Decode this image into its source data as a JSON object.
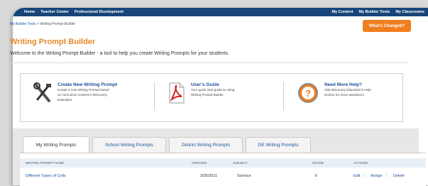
{
  "topnav": {
    "left": [
      "Home",
      "Teacher Center",
      "Professional Development"
    ],
    "right": [
      "My Content",
      "My Builder Tools",
      "My Classrooms"
    ]
  },
  "breadcrumb": {
    "link": "My Builder Tools",
    "sep": " > ",
    "current": "Writing Prompt Builder"
  },
  "whats_changed": "What's Changed?",
  "title": "Writing Prompt Builder",
  "welcome": "Welcome to the Writing Prompt Builder - a tool to help you create Writing Prompts for your students.",
  "info": {
    "create": {
      "title": "Create New Writing Prompt",
      "desc": [
        "Create a new Writing Prompt based",
        "on curriculum content in Discovery",
        "Education"
      ]
    },
    "guide": {
      "title": "User's Guide",
      "desc": [
        "Your quick start guide to using",
        "Writing Prompt Builder"
      ]
    },
    "help": {
      "title": "Need More Help?",
      "desc": [
        "Visit Discovery Education's Help",
        "section for more assistance"
      ]
    }
  },
  "tabs": [
    "My Writing Prompts",
    "School Writing Prompts",
    "District Writing Prompts",
    "DE Writing Prompts"
  ],
  "table": {
    "headers": [
      "WRITING PROMPT NAME",
      "CREATED",
      "SUBJECT",
      "GRADE",
      "ACTIONS"
    ],
    "row": {
      "name": "Different Types of Cells",
      "created": "3/25/2011",
      "subject": "Science",
      "grade": "6",
      "actions": [
        "Edit",
        "Assign",
        "Delete"
      ]
    }
  },
  "colors": {
    "nav": "#17457a",
    "accent": "#e3892a",
    "button": "#f07d1e",
    "link": "#1a4f9c"
  }
}
